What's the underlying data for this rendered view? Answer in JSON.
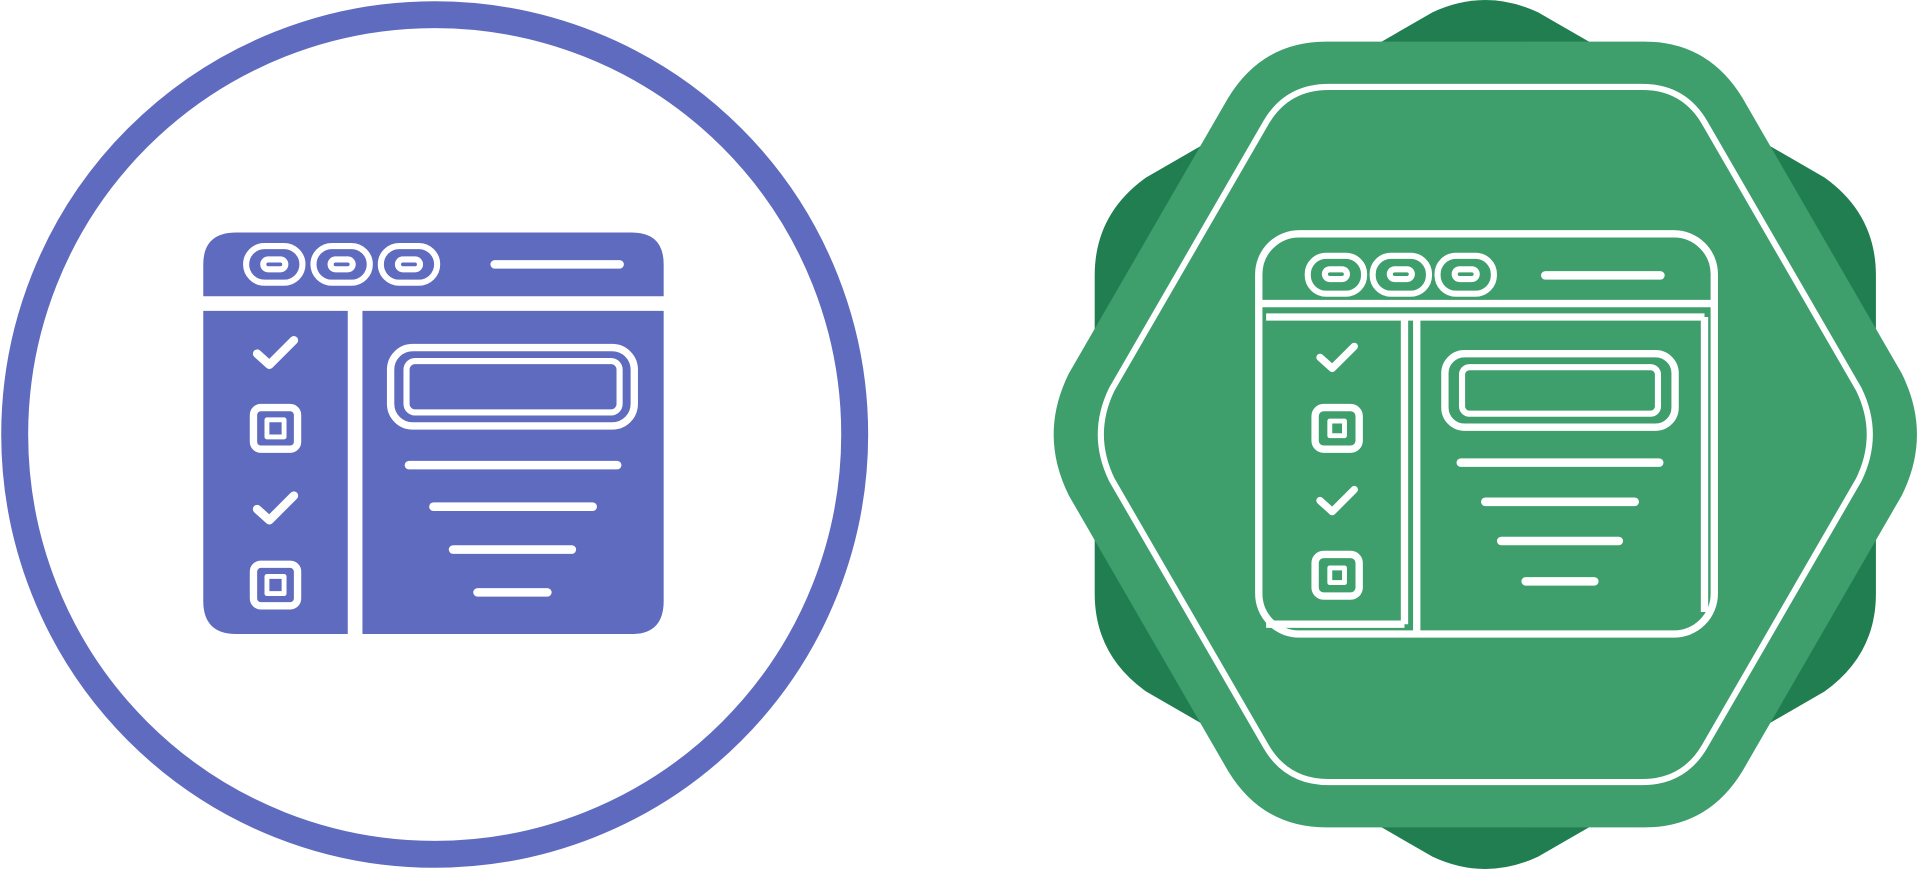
{
  "icons": [
    {
      "name": "checklist-window-glyph-icon",
      "style": "glyph",
      "badge_shape": "circle-outline",
      "colors": {
        "fill": "#5F6BBF",
        "badge_stroke": "#5F6BBF",
        "background": "#FFFFFF",
        "detail": "#FFFFFF"
      },
      "checklist": [
        "checked",
        "unchecked",
        "checked",
        "unchecked"
      ],
      "window_dots": 3,
      "content_lines": 4
    },
    {
      "name": "checklist-window-outline-icon",
      "style": "outline",
      "badge_shape": "octagon-badge",
      "colors": {
        "badge_fill": "#3E9F6D",
        "badge_shadow": "#217E50",
        "stroke": "#FFFFFF"
      },
      "checklist": [
        "checked",
        "unchecked",
        "checked",
        "unchecked"
      ],
      "window_dots": 3,
      "content_lines": 4
    }
  ]
}
